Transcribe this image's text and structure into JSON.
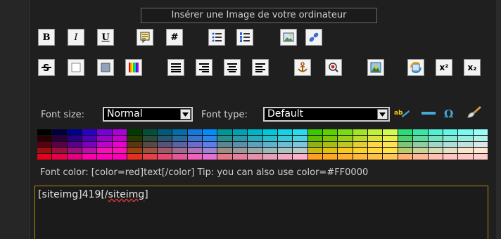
{
  "header": {
    "insert_image_label": "Insérer une Image de votre ordinateur"
  },
  "toolbar_row1": {
    "bold": "B",
    "italic": "I",
    "underline": "U",
    "hash": "#"
  },
  "toolbar_row2": {
    "superscript": "x²",
    "subscript": "x₂"
  },
  "font": {
    "size_label": "Font size:",
    "size_value": "Normal",
    "type_label": "Font type:",
    "type_value": "Default"
  },
  "tip": {
    "text": "Font color: [color=red]text[/color]  Tip: you can also use color=#FF0000"
  },
  "editor": {
    "value_prefix": "[siteimg]419[/",
    "value_word": "siteimg",
    "value_suffix": "]"
  },
  "colors": {
    "accent_border": "#b8860b"
  }
}
